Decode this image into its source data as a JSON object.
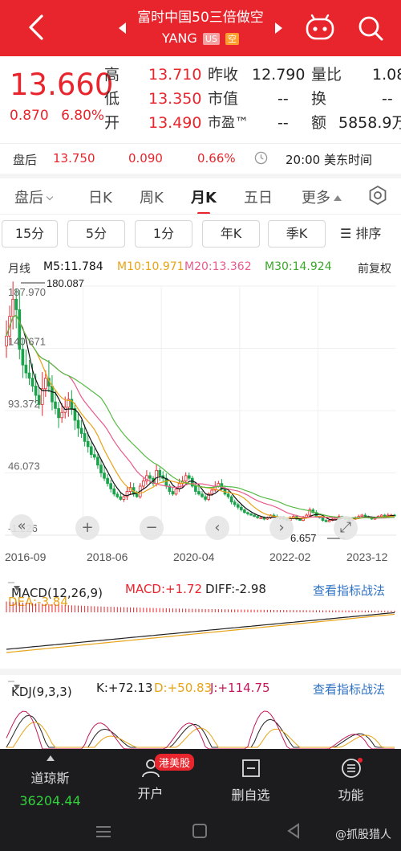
{
  "header": {
    "title": "富时中国50三倍做空",
    "ticker": "YANG",
    "badge_market": "US",
    "badge_type": "空"
  },
  "quote": {
    "price": "13.660",
    "change": "0.870",
    "change_pct": "6.80%",
    "high_label": "高",
    "high": "13.710",
    "low_label": "低",
    "low": "13.350",
    "open_label": "开",
    "open": "13.490",
    "prev_close_label": "昨收",
    "prev_close": "12.790",
    "mkt_cap_label": "市值",
    "mkt_cap": "--",
    "pe_label": "市盈™",
    "pe": "--",
    "vol_ratio_label": "量比",
    "vol_ratio": "1.08",
    "turnover_label": "换",
    "turnover": "--",
    "amount_label": "额",
    "amount": "5858.9万"
  },
  "after_hours": {
    "label": "盘后",
    "price": "13.750",
    "change": "0.090",
    "change_pct": "0.66%",
    "time": "20:00 美东时间"
  },
  "tabs": [
    "盘后",
    "日K",
    "周K",
    "月K",
    "五日",
    "更多"
  ],
  "active_tab": "月K",
  "chips": [
    "15分",
    "5分",
    "1分",
    "年K",
    "季K"
  ],
  "sort_label": "排序",
  "chart": {
    "line_label": "月线",
    "ma5": "M5:11.784",
    "ma10": "M10:10.971",
    "ma20": "M20:13.362",
    "ma30": "M30:14.924",
    "adjust": "前复权",
    "y_labels": [
      "187.970",
      "140.671",
      "93.372",
      "46.073",
      "-1.226"
    ],
    "max_label": "180.087",
    "min_label": "6.657",
    "x_labels": [
      "2016-09",
      "2018-06",
      "2020-04",
      "2022-02",
      "2023-12"
    ],
    "colors": {
      "ma5": "#111111",
      "ma10": "#e8a317",
      "ma20": "#e85a8c",
      "ma30": "#55bb44",
      "up": "#e8252c",
      "down": "#1aa34a"
    }
  },
  "chart_data": {
    "type": "candlestick",
    "title": "",
    "y_ticks": [
      187.97,
      140.671,
      93.372,
      46.073,
      -1.226
    ],
    "ylim": [
      -1.226,
      187.97
    ],
    "x_ticks": [
      "2016-09",
      "2018-06",
      "2020-04",
      "2022-02",
      "2023-12"
    ],
    "annotations": [
      {
        "text": "180.087",
        "kind": "max"
      },
      {
        "text": "6.657",
        "kind": "min"
      }
    ],
    "series": [
      {
        "name": "M5",
        "last": 11.784
      },
      {
        "name": "M10",
        "last": 10.971
      },
      {
        "name": "M20",
        "last": 13.362
      },
      {
        "name": "M30",
        "last": 14.924
      }
    ],
    "close_approx": [
      150,
      165,
      178,
      170,
      140,
      128,
      122,
      118,
      112,
      105,
      98,
      110,
      118,
      112,
      100,
      95,
      88,
      92,
      96,
      102,
      95,
      86,
      80,
      76,
      70,
      66,
      60,
      58,
      52,
      46,
      42,
      38,
      34,
      30,
      28,
      26,
      28,
      32,
      35,
      30,
      28,
      36,
      40,
      44,
      42,
      38,
      48,
      44,
      42,
      36,
      32,
      30,
      34,
      38,
      40,
      44,
      42,
      36,
      32,
      30,
      28,
      26,
      30,
      33,
      36,
      38,
      34,
      30,
      28,
      24,
      22,
      20,
      18,
      16,
      15,
      14,
      13,
      12,
      12,
      11,
      12,
      14,
      13,
      12,
      12,
      11,
      10,
      12,
      13,
      11,
      10,
      12,
      14,
      18,
      16,
      13,
      12,
      10,
      9,
      10,
      11,
      12,
      13,
      12,
      11,
      10,
      11,
      12,
      13,
      14,
      13,
      12,
      11,
      12,
      13,
      14,
      13,
      14,
      14,
      13.66
    ]
  },
  "macd": {
    "label": "MACD(12,26,9)",
    "macd": "MACD:+1.72",
    "diff": "DIFF:-2.98",
    "dea": "DEA:-3.84",
    "link": "查看指标战法"
  },
  "kdj": {
    "label": "KDJ(9,3,3)",
    "k": "K:+72.13",
    "d": "D:+50.83",
    "j": "J:+114.75",
    "link": "查看指标战法"
  },
  "bottom": {
    "index_name": "道琼斯",
    "index_value": "36204.44",
    "open_account": "开户",
    "hk_us_badge": "港美股",
    "remove_watch": "删自选",
    "functions": "功能"
  },
  "watermark": "@抓股猎人"
}
